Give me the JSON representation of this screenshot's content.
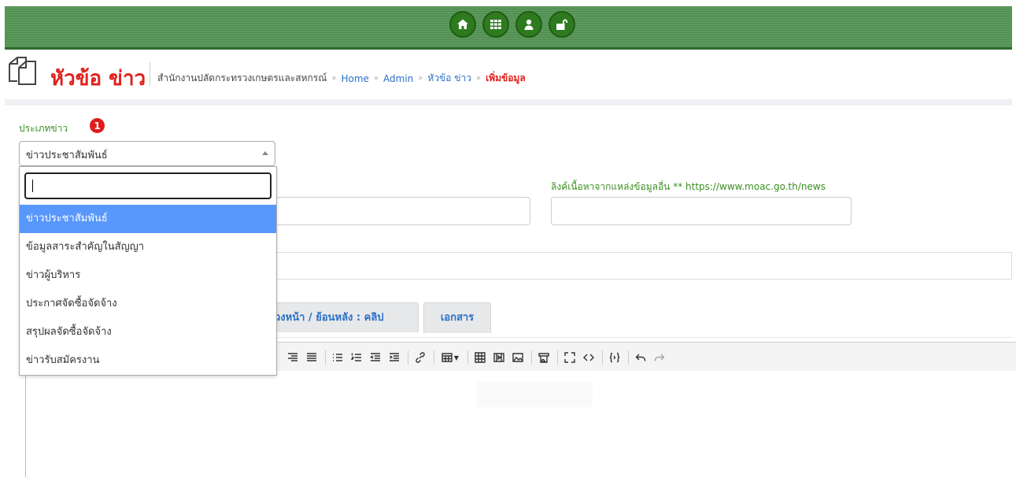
{
  "topbar": {
    "icons": [
      "home-icon",
      "grid-icon",
      "user-icon",
      "unlock-icon"
    ]
  },
  "header": {
    "title": "หัวข้อ ข่าว",
    "breadcrumb": {
      "org": "สำนักงานปลัดกระทรวงเกษตรและสหกรณ์",
      "home": "Home",
      "admin": "Admin",
      "section": "หัวข้อ ข่าว",
      "current": "เพิ่มข้อมูล",
      "separator": "»"
    }
  },
  "form": {
    "news_type_label": "ประเภทข่าว",
    "news_type_step": "1",
    "news_type_value": "ข่าวประชาสัมพันธ์",
    "dropdown_search_value": "",
    "dropdown_options": [
      "ข่าวประชาสัมพันธ์",
      "ข้อมูลสาระสำคัญในสัญญา",
      "ข่าวผู้บริหาร",
      "ประกาศจัดซื้อจัดจ้าง",
      "สรุปผลจัดซื้อจัดจ้าง",
      "ข่าวรับสมัครงาน"
    ],
    "selected_option_index": 0,
    "link_label": "ลิงค์เนื้อหาจากแหล่งข้อมูลอื่น ** https://www.moac.go.th/news",
    "input1_value": "",
    "link_value": ""
  },
  "tabs": [
    {
      "label": "วงหน้า / ย้อนหลัง : คลิป"
    },
    {
      "label": "เอกสาร"
    }
  ],
  "colors": {
    "brand_green": "#2e7a1f",
    "title_red": "#e0201c",
    "link_blue": "#2a6fc9",
    "select_highlight": "#5897fb"
  }
}
